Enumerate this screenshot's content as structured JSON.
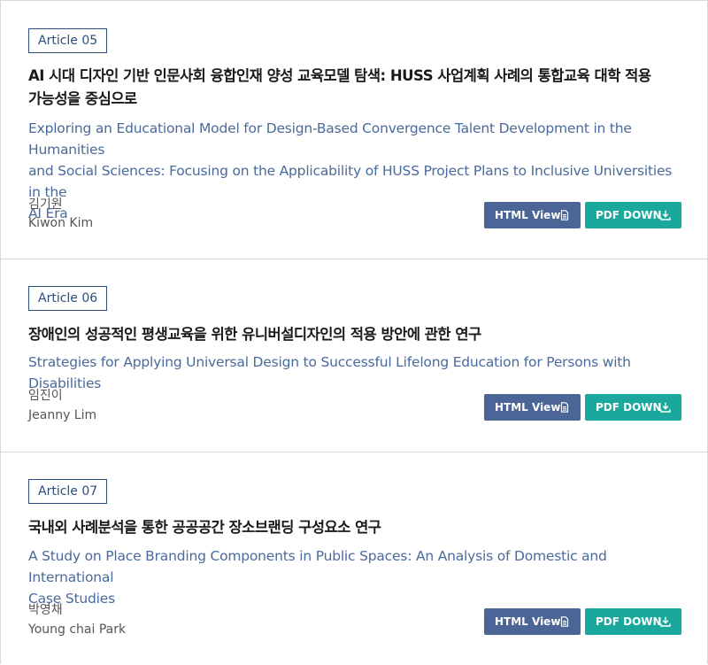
{
  "articles": [
    {
      "badge": "Article 05",
      "title_ko_lines": [
        "AI 시대 디자인 기반 인문사회 융합인재 양성 교육모델 탐색: HUSS 사업계획 사례의 통합교육 대학 적용",
        "가능성을 중심으로"
      ],
      "title_en_lines": [
        "Exploring an Educational Model for Design-Based Convergence Talent Development in the Humanities",
        "and Social Sciences: Focusing on the Applicability of HUSS Project Plans to Inclusive Universities in the",
        "AI Era"
      ],
      "author_ko": "김기원",
      "author_en": "Kiwon Kim",
      "html_label": "HTML View",
      "pdf_label": "PDF DOWN"
    },
    {
      "badge": "Article 06",
      "title_ko_lines": [
        "장애인의 성공적인 평생교육을 위한 유니버설디자인의 적용 방안에 관한 연구"
      ],
      "title_en_lines": [
        "Strategies for Applying Universal Design to Successful Lifelong Education for Persons with Disabilities"
      ],
      "author_ko": "임진이",
      "author_en": "Jeanny Lim",
      "html_label": "HTML View",
      "pdf_label": "PDF DOWN"
    },
    {
      "badge": "Article 07",
      "title_ko_lines": [
        "국내외 사례분석을 통한 공공공간 장소브랜딩 구성요소 연구"
      ],
      "title_en_lines": [
        "A Study on Place Branding Components in Public Spaces: An Analysis of Domestic and International",
        "Case Studies"
      ],
      "author_ko": "박영채",
      "author_en": "Young chai Park",
      "html_label": "HTML View",
      "pdf_label": "PDF DOWN"
    }
  ],
  "colors": {
    "badge": "#2b4e7c",
    "title_en": "#4a6a9c",
    "html_button": "#4a6596",
    "pdf_button": "#1aa89c"
  },
  "icons": {
    "html_button": "document-icon",
    "pdf_button": "download-icon"
  }
}
